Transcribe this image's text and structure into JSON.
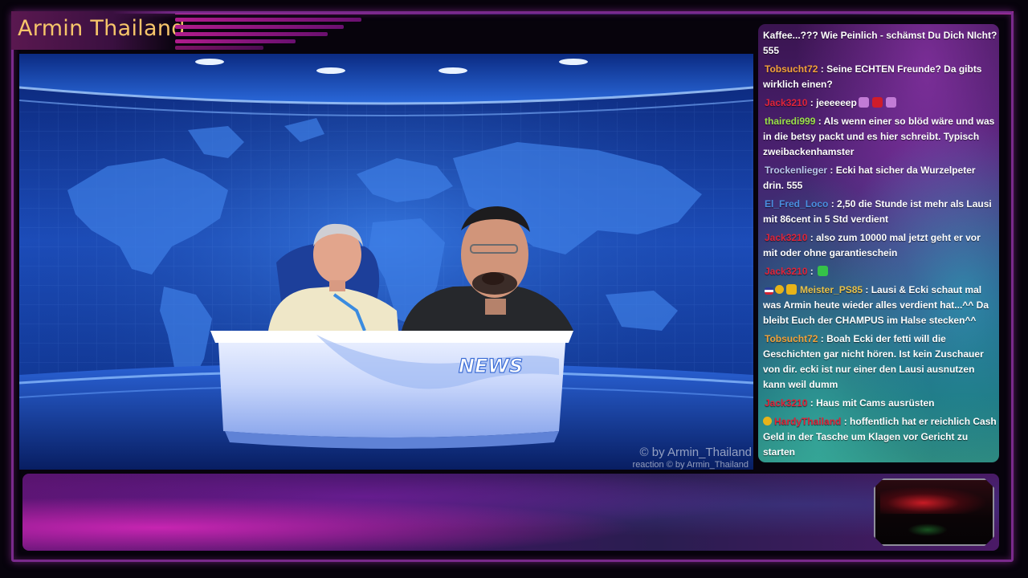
{
  "stream": {
    "channel_title": "Armin Thailand",
    "desk_text": "NEWS",
    "watermark": "© by Armin_Thailand",
    "watermark_small": "reaction  © by Armin_Thailand"
  },
  "colors": {
    "title": "#f6c56a",
    "frame": "#7a2a8c",
    "studio_blue": "#0b2f86"
  },
  "chat": {
    "messages": [
      {
        "user": "",
        "user_color": "#ffffff",
        "prefix": "",
        "text": "Kaffee...??? Wie Peinlich - schämst Du Dich NIcht? 555"
      },
      {
        "user": "Tobsucht72",
        "user_color": "#f4a23a",
        "prefix": "",
        "text": "Seine ECHTEN Freunde? Da gibts wirklich einen?"
      },
      {
        "user": "Jack3210",
        "user_color": "#e0243a",
        "prefix": "",
        "text": "jeeeeeep",
        "emotes": [
          "#c27bd6",
          "#d01c2a",
          "#c27bd6"
        ]
      },
      {
        "user": "thairedi999",
        "user_color": "#9be14a",
        "prefix": "",
        "text": "Als wenn einer so blöd wäre und was in die betsy packt und es hier schreibt. Typisch zweibackenhamster"
      },
      {
        "user": "Trockenlieger",
        "user_color": "#b9c7ea",
        "prefix": "",
        "text": "Ecki hat sicher da Wurzelpeter drin. 555"
      },
      {
        "user": "El_Fred_Loco",
        "user_color": "#4a8fe0",
        "prefix": "",
        "text": "2,50 die Stunde ist mehr als Lausi mit 86cent in 5 Std verdient"
      },
      {
        "user": "Jack3210",
        "user_color": "#e0243a",
        "prefix": "",
        "text": "also zum 10000 mal jetzt geht er vor mit oder ohne garantieschein"
      },
      {
        "user": "Jack3210",
        "user_color": "#e0243a",
        "prefix": "",
        "text": "",
        "emotes": [
          "#35c248"
        ]
      },
      {
        "user": "Meister_PS85",
        "user_color": "#e9c24a",
        "prefix": "badges",
        "text": "Lausi & Ecki schaut mal was Armin heute wieder alles verdient hat...^^ Da bleibt Euch der CHAMPUS im Halse stecken^^"
      },
      {
        "user": "Tobsucht72",
        "user_color": "#f4a23a",
        "prefix": "",
        "text": "Boah Ecki der fetti will die Geschichten gar nicht hören. Ist kein Zuschauer von dir. ecki ist nur einer den Lausi ausnutzen kann weil dumm"
      },
      {
        "user": "Jack3210",
        "user_color": "#e0243a",
        "prefix": "",
        "text": "Haus mit Cams ausrüsten"
      },
      {
        "user": "HardyThailand",
        "user_color": "#e0243a",
        "prefix": "coin",
        "text": "hoffentlich hat er reichlich Cash Geld in der Tasche um Klagen vor Gericht zu starten"
      }
    ]
  }
}
